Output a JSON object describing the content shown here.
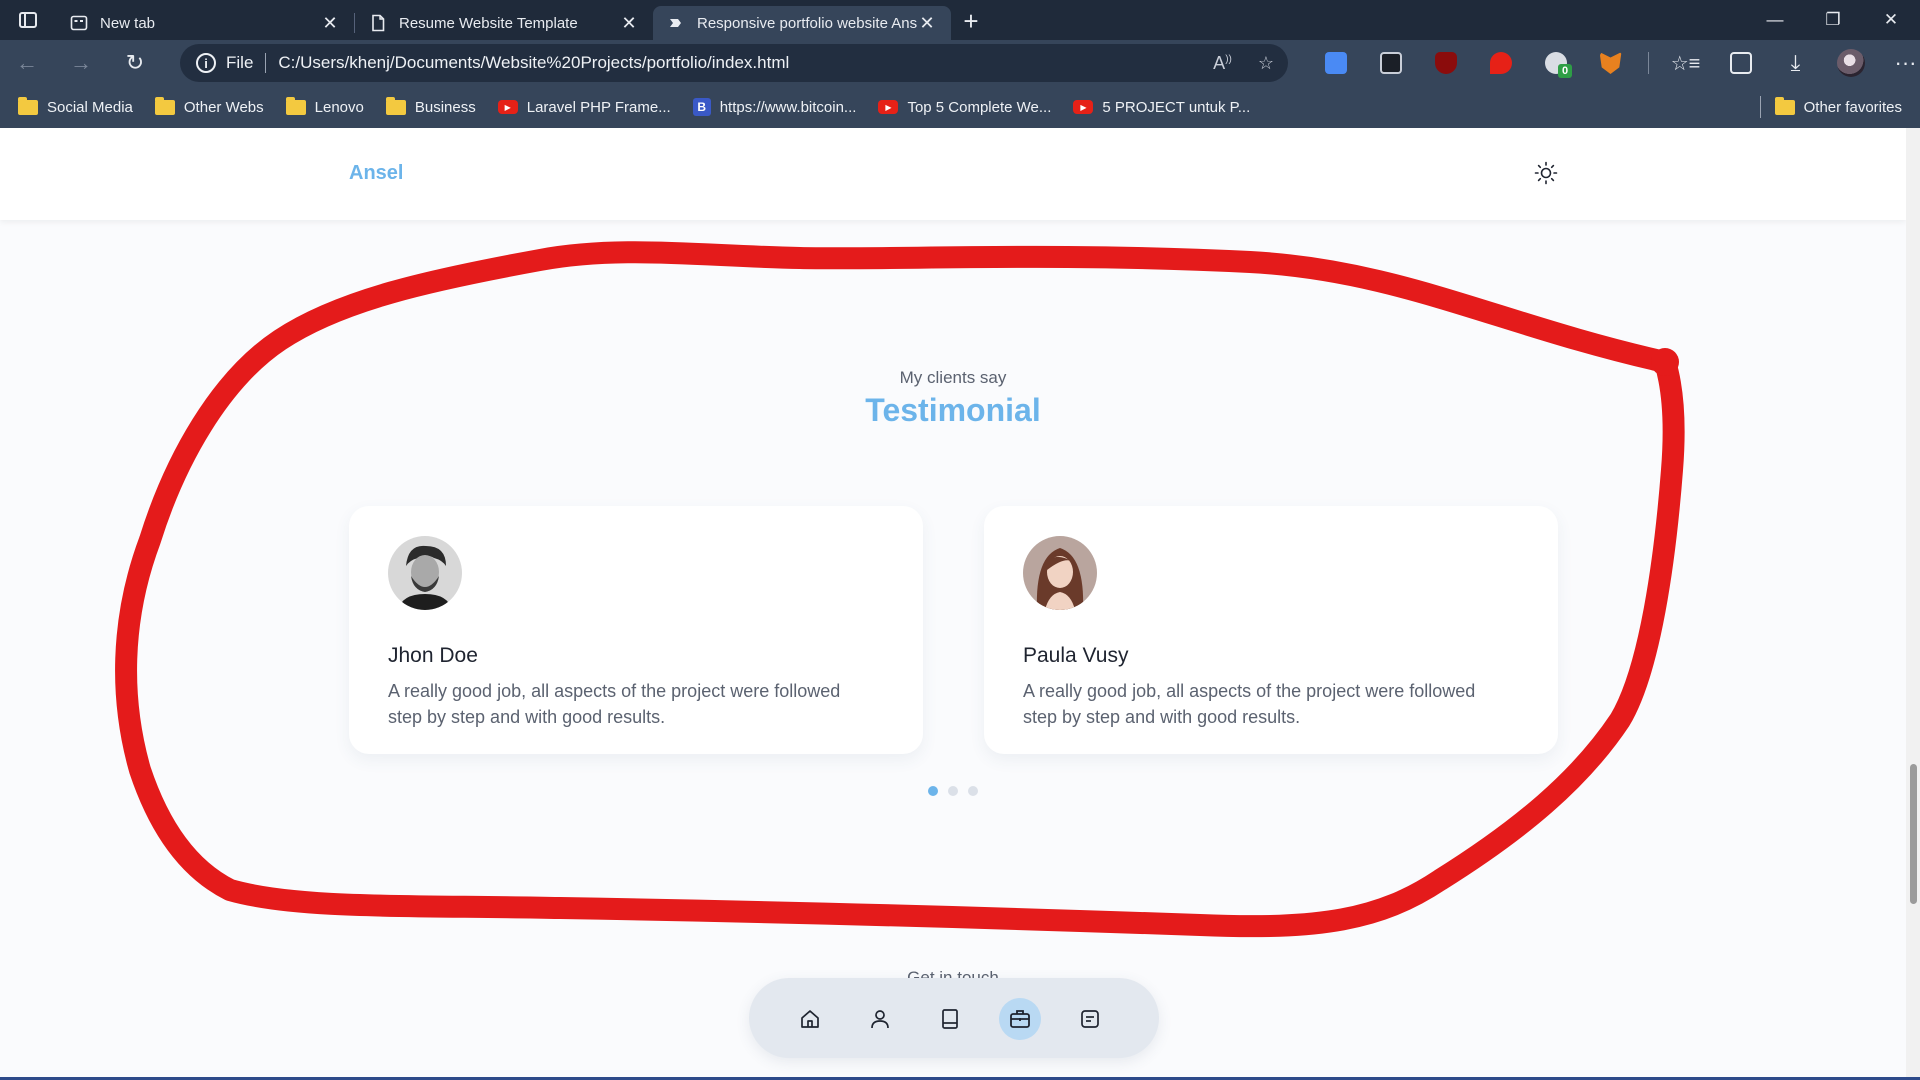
{
  "browser": {
    "tabs": [
      {
        "title": "New tab",
        "active": false
      },
      {
        "title": "Resume Website Template",
        "active": false
      },
      {
        "title": "Responsive portfolio website Ansel",
        "active": true
      }
    ],
    "address": {
      "protocol_label": "File",
      "url": "C:/Users/khenj/Documents/Website%20Projects/portfolio/index.html"
    },
    "bookmarks": [
      {
        "label": "Social Media",
        "icon": "folder-icon"
      },
      {
        "label": "Other Webs",
        "icon": "folder-icon"
      },
      {
        "label": "Lenovo",
        "icon": "folder-icon"
      },
      {
        "label": "Business",
        "icon": "folder-icon"
      },
      {
        "label": "Laravel PHP Frame...",
        "icon": "youtube-icon"
      },
      {
        "label": "https://www.bitcoin...",
        "icon": "bitcoin-b-icon"
      },
      {
        "label": "Top 5 Complete We...",
        "icon": "youtube-icon"
      },
      {
        "label": "5 PROJECT untuk P...",
        "icon": "youtube-icon"
      }
    ],
    "other_favorites": "Other favorites",
    "extensions": {
      "badge": "0"
    }
  },
  "site": {
    "logo": "Ansel",
    "section": {
      "subtitle": "My clients say",
      "title": "Testimonial"
    },
    "testimonials": [
      {
        "name": "Jhon Doe",
        "text": "A really good job, all aspects of the project were followed step by step and with good results."
      },
      {
        "name": "Paula Vusy",
        "text": "A really good job, all aspects of the project were followed step by step and with good results."
      }
    ],
    "pagination": {
      "count": 3,
      "active": 0
    },
    "next_section_peek": "Get in touch",
    "nav": [
      "home-icon",
      "user-icon",
      "book-icon",
      "briefcase-icon",
      "message-icon"
    ],
    "nav_active": 3
  },
  "colors": {
    "accent": "#6cb4ea",
    "annotation": "#e41b1b",
    "browser_frame": "#36455a"
  }
}
